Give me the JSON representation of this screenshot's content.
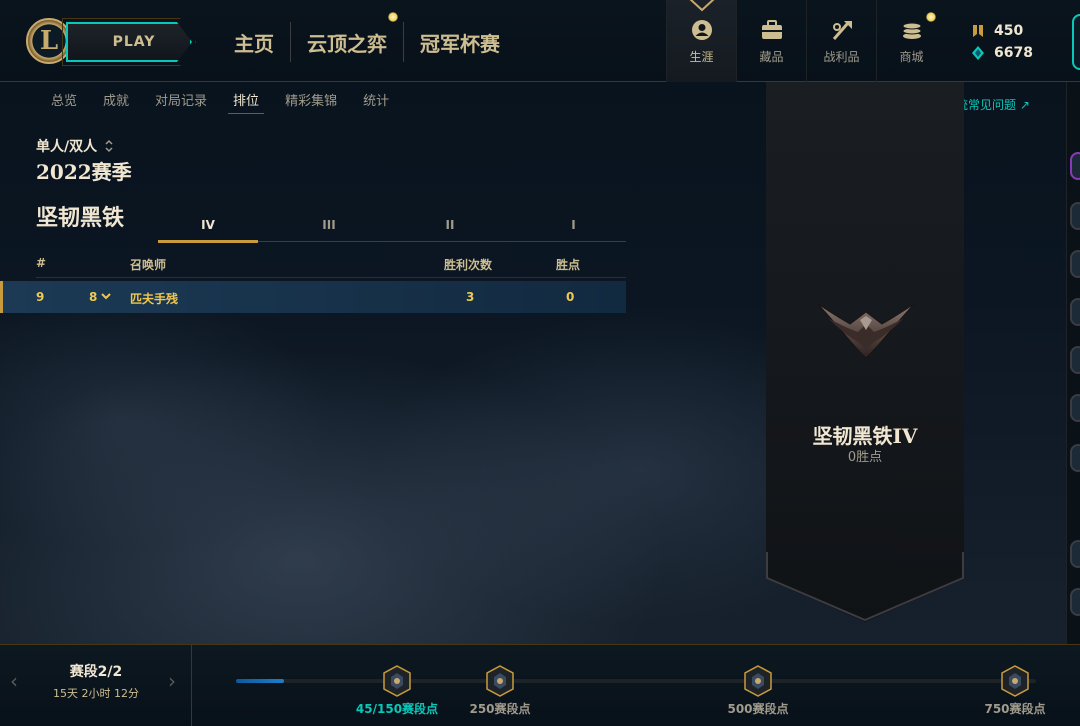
{
  "header": {
    "logo_letter": "L",
    "play_label": "PLAY",
    "nav": [
      "主页",
      "云顶之弈",
      "冠军杯赛"
    ],
    "tabs": [
      {
        "label": "生涯",
        "icon": "profile-icon",
        "active": true
      },
      {
        "label": "藏品",
        "icon": "collection-icon",
        "active": false
      },
      {
        "label": "战利品",
        "icon": "loot-icon",
        "active": false
      },
      {
        "label": "商城",
        "icon": "store-icon",
        "active": false
      }
    ],
    "currency": {
      "rp": "450",
      "be": "6678"
    }
  },
  "subnav": {
    "items": [
      "总览",
      "成就",
      "对局记录",
      "排位",
      "精彩集锦",
      "统计"
    ],
    "active_index": 3,
    "faq_link": "战区系统常见问题 ↗"
  },
  "ranked": {
    "queue_label": "单人/双人",
    "season": "2022赛季",
    "tier_name": "坚韧黑铁",
    "divisions": [
      "IV",
      "III",
      "II",
      "I"
    ],
    "active_division": 0,
    "columns": {
      "rank": "#",
      "summoner": "召唤师",
      "wins": "胜利次数",
      "lp": "胜点"
    },
    "me": {
      "rank": "9",
      "change": "8",
      "name": "匹夫手残",
      "wins": "3",
      "lp": "0"
    }
  },
  "banner": {
    "tier_title": "坚韧黑铁IV",
    "lp_label": "0胜点"
  },
  "progression": {
    "stage_title": "赛段2/2",
    "time_left": "15天 2小时 12分",
    "current_value": 45,
    "max_value": 750,
    "milestones": [
      {
        "value": 150,
        "label": "45/150赛段点",
        "current": true
      },
      {
        "value": 250,
        "label": "250赛段点",
        "current": false
      },
      {
        "value": 500,
        "label": "500赛段点",
        "current": false
      },
      {
        "value": 750,
        "label": "750赛段点",
        "current": false
      }
    ]
  },
  "colors": {
    "gold": "#c89b3c",
    "teal": "#0ac8b9",
    "text_light": "#f0e6d2"
  }
}
